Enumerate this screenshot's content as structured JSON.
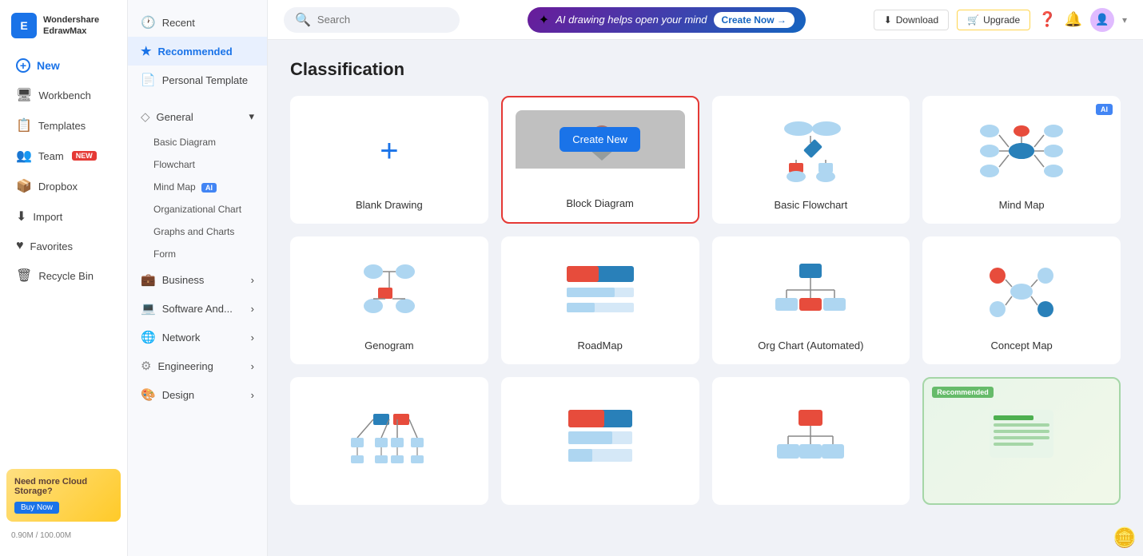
{
  "app": {
    "name": "Wondershare",
    "subname": "EdrawMax"
  },
  "topbar": {
    "search_placeholder": "Search",
    "ai_banner_text": "AI drawing helps open your mind",
    "create_now_label": "Create Now →",
    "download_label": "Download",
    "upgrade_label": "Upgrade"
  },
  "sidebar": {
    "new_label": "New",
    "workbench_label": "Workbench",
    "templates_label": "Templates",
    "team_label": "Team",
    "team_badge": "NEW",
    "dropbox_label": "Dropbox",
    "import_label": "Import",
    "favorites_label": "Favorites",
    "recycle_label": "Recycle Bin",
    "promo_title": "Need more Cloud Storage?",
    "buy_now_label": "Buy Now",
    "storage_text": "0.90M / 100.00M"
  },
  "middle_panel": {
    "items": [
      {
        "id": "recent",
        "label": "Recent",
        "icon": "🕐"
      },
      {
        "id": "recommended",
        "label": "Recommended",
        "icon": "★",
        "active": true
      },
      {
        "id": "personal-template",
        "label": "Personal Template",
        "icon": "📄"
      }
    ],
    "sections": [
      {
        "id": "general",
        "label": "General",
        "icon": "◇",
        "expanded": true,
        "sub_items": [
          {
            "id": "basic-diagram",
            "label": "Basic Diagram"
          },
          {
            "id": "flowchart",
            "label": "Flowchart"
          },
          {
            "id": "mind-map",
            "label": "Mind Map",
            "ai": true
          },
          {
            "id": "org-chart",
            "label": "Organizational Chart"
          },
          {
            "id": "graphs-charts",
            "label": "Graphs and Charts"
          },
          {
            "id": "form",
            "label": "Form"
          }
        ]
      },
      {
        "id": "business",
        "label": "Business",
        "icon": "💼",
        "has_arrow": true
      },
      {
        "id": "software",
        "label": "Software And...",
        "icon": "💻",
        "has_arrow": true
      },
      {
        "id": "network",
        "label": "Network",
        "icon": "🌐",
        "has_arrow": true
      },
      {
        "id": "engineering",
        "label": "Engineering",
        "icon": "⚙",
        "has_arrow": true
      },
      {
        "id": "design",
        "label": "Design",
        "icon": "🎨",
        "has_arrow": true
      }
    ]
  },
  "main": {
    "section_title": "Classification",
    "cards": [
      {
        "id": "blank-drawing",
        "label": "Blank Drawing",
        "type": "blank"
      },
      {
        "id": "block-diagram",
        "label": "Block Diagram",
        "type": "selected",
        "has_create": true
      },
      {
        "id": "basic-flowchart",
        "label": "Basic Flowchart",
        "type": "flowchart"
      },
      {
        "id": "mind-map",
        "label": "Mind Map",
        "type": "mindmap",
        "ai_badge": true
      },
      {
        "id": "genogram",
        "label": "Genogram",
        "type": "genogram"
      },
      {
        "id": "roadmap",
        "label": "RoadMap",
        "type": "roadmap"
      },
      {
        "id": "org-chart-auto",
        "label": "Org Chart (Automated)",
        "type": "orgchart"
      },
      {
        "id": "concept-map",
        "label": "Concept Map",
        "type": "concept"
      },
      {
        "id": "network-card1",
        "label": "",
        "type": "network1"
      },
      {
        "id": "network-card2",
        "label": "",
        "type": "network2"
      },
      {
        "id": "network-card3",
        "label": "",
        "type": "network3"
      },
      {
        "id": "recommended-card",
        "label": "",
        "type": "recommended",
        "recommended_badge": true
      }
    ],
    "create_new_label": "Create New"
  }
}
